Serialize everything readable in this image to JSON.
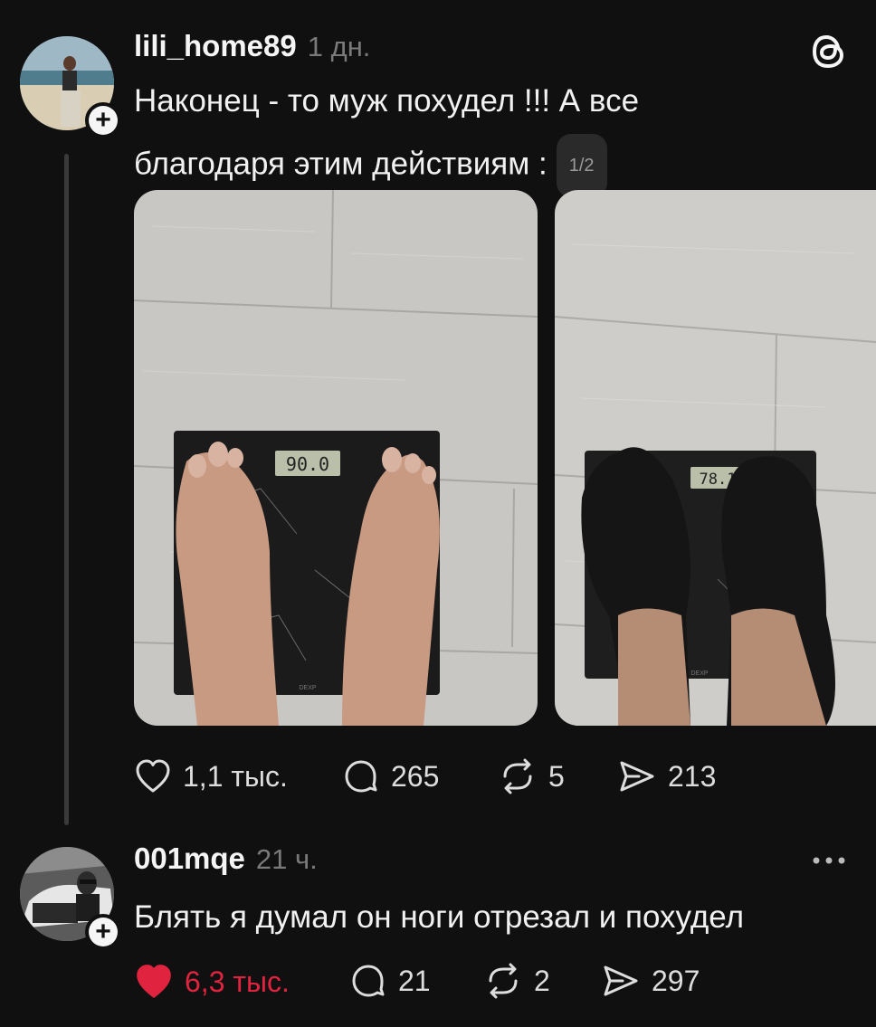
{
  "post": {
    "username": "lili_home89",
    "time": "1 дн.",
    "text_line1": "Наконец - то муж похудел !!! А все",
    "text_line2": "благодаря этим действиям :",
    "pager": "1/2",
    "scale_before": "90.0",
    "scale_after": "78.1",
    "scale_brand": "DEXP",
    "actions": {
      "likes": "1,1 тыс.",
      "comments": "265",
      "reposts": "5",
      "shares": "213"
    }
  },
  "reply": {
    "username": "001mqe",
    "time": "21 ч.",
    "text": "Блять я думал он ноги отрезал и похудел",
    "actions": {
      "likes": "6,3 тыс.",
      "comments": "21",
      "reposts": "2",
      "shares": "297"
    }
  },
  "icons": {
    "app_logo": "threads-logo-icon",
    "like": "heart-icon",
    "comment": "speech-bubble-icon",
    "repost": "repost-icon",
    "share": "send-icon",
    "more": "more-dots-icon"
  },
  "colors": {
    "background": "#101010",
    "liked": "#e0243f",
    "muted": "#7a7a7a"
  }
}
